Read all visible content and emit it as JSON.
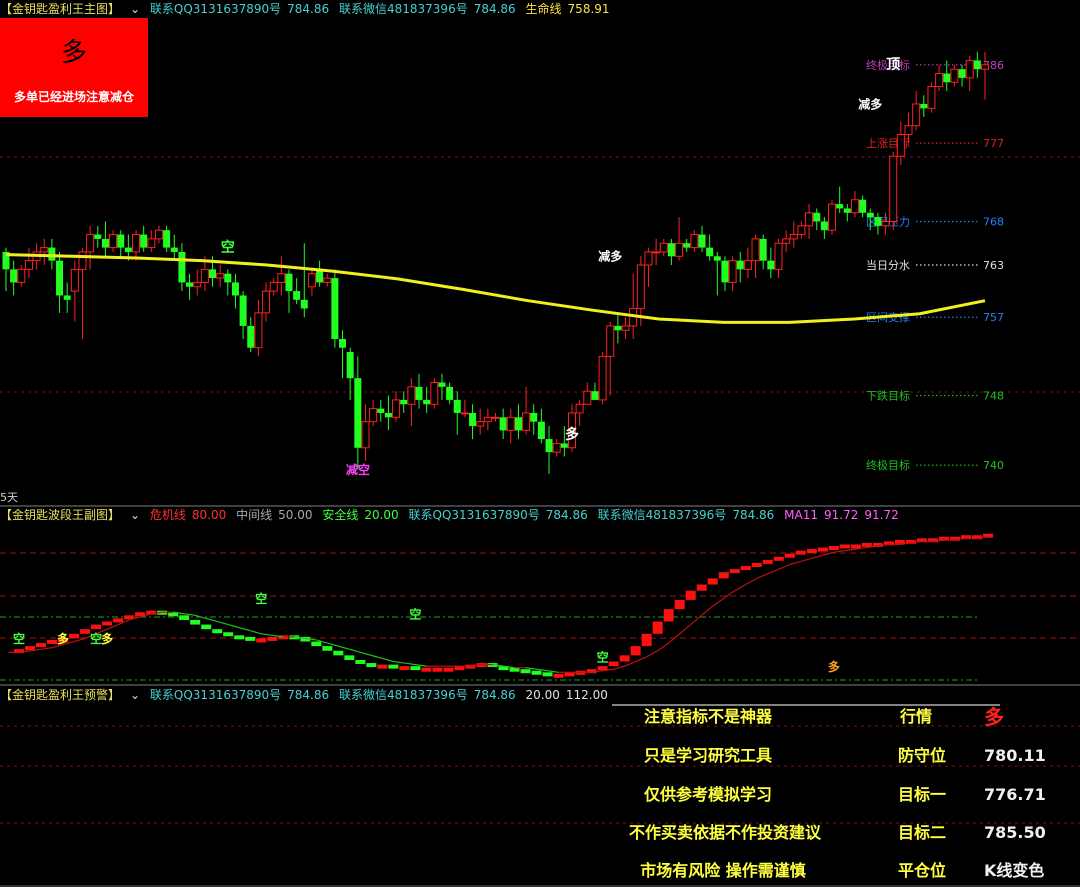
{
  "main_header": {
    "title": "【金钥匙盈利王主图】",
    "qq": "联系QQ3131637890号",
    "qq_val": "784.86",
    "wx": "联系微信481837396号",
    "wx_val": "784.86",
    "life_line_label": "生命线",
    "life_line_val": "758.91"
  },
  "signal_box": {
    "big": "多",
    "small": "多单已经进场注意减仓"
  },
  "days_label": "5天",
  "sub_header": {
    "title": "【金钥匙波段王副图】",
    "danger": "危机线",
    "danger_val": "80.00",
    "mid": "中间线",
    "mid_val": "50.00",
    "safe": "安全线",
    "safe_val": "20.00",
    "qq": "联系QQ3131637890号",
    "qq_val": "784.86",
    "wx": "联系微信481837396号",
    "wx_val": "784.86",
    "ma": "MA11",
    "ma_val": "91.72",
    "ma_val2": "91.72"
  },
  "warn_header": {
    "title": "【金钥匙盈利王预警】",
    "qq": "联系QQ3131637890号",
    "qq_val": "784.86",
    "wx": "联系微信481837396号",
    "wx_val": "784.86",
    "v1": "20.00",
    "v2": "112.00"
  },
  "info_table": [
    {
      "left": "注意指标不是神器",
      "key": "行情",
      "val": "多"
    },
    {
      "left": "只是学习研究工具",
      "key": "防守位",
      "val": "780.11"
    },
    {
      "left": "仅供参考模拟学习",
      "key": "目标一",
      "val": "776.71"
    },
    {
      "left": "不作买卖依据不作投资建议",
      "key": "目标二",
      "val": "785.50"
    },
    {
      "left": "市场有风险 操作需谨慎",
      "key": "平仓位",
      "val": "K线变色"
    }
  ],
  "chart_data": [
    {
      "type": "candlestick",
      "panel": "main",
      "ylim": [
        736,
        790
      ],
      "levels": [
        {
          "name": "终极目标",
          "value": 786,
          "color": "#c040c0"
        },
        {
          "name": "上涨目标",
          "value": 777,
          "color": "#e02020"
        },
        {
          "name": "区间压力",
          "value": 768,
          "color": "#2080ff"
        },
        {
          "name": "当日分水",
          "value": 763,
          "color": "#e0e0e0"
        },
        {
          "name": "区间支撑",
          "value": 757,
          "color": "#2080ff"
        },
        {
          "name": "下跌目标",
          "value": 748,
          "color": "#20c020"
        },
        {
          "name": "终极目标",
          "value": 740,
          "color": "#20c020"
        }
      ],
      "candles": [
        [
          764.5,
          762.5,
          760.0,
          765.0
        ],
        [
          762.5,
          761.0,
          759.5,
          763.5
        ],
        [
          761.0,
          762.5,
          760.5,
          763.0
        ],
        [
          762.5,
          763.5,
          761.5,
          765.0
        ],
        [
          763.5,
          764.5,
          762.5,
          765.5
        ],
        [
          764.5,
          765.0,
          763.0,
          766.0
        ],
        [
          765.0,
          763.5,
          762.5,
          766.0
        ],
        [
          763.5,
          759.5,
          757.5,
          764.5
        ],
        [
          759.5,
          759.0,
          757.5,
          761.0
        ],
        [
          760.0,
          762.5,
          756.5,
          763.5
        ],
        [
          762.5,
          764.5,
          754.5,
          765.0
        ],
        [
          764.5,
          766.5,
          762.5,
          767.5
        ],
        [
          766.5,
          766.0,
          765.0,
          767.5
        ],
        [
          766.0,
          765.0,
          764.0,
          768.0
        ],
        [
          765.0,
          766.5,
          764.5,
          767.0
        ],
        [
          766.5,
          765.0,
          764.0,
          767.0
        ],
        [
          765.0,
          764.5,
          763.5,
          766.5
        ],
        [
          764.5,
          766.5,
          763.5,
          767.0
        ],
        [
          766.5,
          765.0,
          764.5,
          767.5
        ],
        [
          765.0,
          766.0,
          764.5,
          767.0
        ],
        [
          766.0,
          767.0,
          765.5,
          767.5
        ],
        [
          767.0,
          765.0,
          764.5,
          767.5
        ],
        [
          765.0,
          764.5,
          763.5,
          766.5
        ],
        [
          764.5,
          761.0,
          760.0,
          765.5
        ],
        [
          761.0,
          760.5,
          759.0,
          762.0
        ],
        [
          760.5,
          761.0,
          759.5,
          762.5
        ],
        [
          761.0,
          762.5,
          760.0,
          764.0
        ],
        [
          762.5,
          761.5,
          760.5,
          764.0
        ],
        [
          761.5,
          762.0,
          760.5,
          763.0
        ],
        [
          762.0,
          761.0,
          759.5,
          762.5
        ],
        [
          761.0,
          759.5,
          758.0,
          762.0
        ],
        [
          759.5,
          756.0,
          754.5,
          760.0
        ],
        [
          756.0,
          753.5,
          753.0,
          757.0
        ],
        [
          753.5,
          757.5,
          752.5,
          759.0
        ],
        [
          757.5,
          760.0,
          756.5,
          761.0
        ],
        [
          760.0,
          761.0,
          759.5,
          761.5
        ],
        [
          761.0,
          762.0,
          759.5,
          764.0
        ],
        [
          762.0,
          760.0,
          757.5,
          762.5
        ],
        [
          760.0,
          759.0,
          758.5,
          761.5
        ],
        [
          759.0,
          758.0,
          757.0,
          765.5
        ],
        [
          760.5,
          762.0,
          759.5,
          762.5
        ],
        [
          762.5,
          761.0,
          760.5,
          763.5
        ],
        [
          761.0,
          761.5,
          760.5,
          762.0
        ],
        [
          761.5,
          754.5,
          753.5,
          762.5
        ],
        [
          754.5,
          753.5,
          750.0,
          755.5
        ],
        [
          753.0,
          750.0,
          747.5,
          753.5
        ],
        [
          750.0,
          742.0,
          739.5,
          752.5
        ],
        [
          742.0,
          745.0,
          740.5,
          747.0
        ],
        [
          745.0,
          746.5,
          744.5,
          747.5
        ],
        [
          746.5,
          746.0,
          745.0,
          747.5
        ],
        [
          746.0,
          745.5,
          744.0,
          748.0
        ],
        [
          745.5,
          747.5,
          745.0,
          748.5
        ],
        [
          747.5,
          747.0,
          746.0,
          748.5
        ],
        [
          747.0,
          749.0,
          744.5,
          750.0
        ],
        [
          749.0,
          747.5,
          746.5,
          750.5
        ],
        [
          747.5,
          747.0,
          746.0,
          749.0
        ],
        [
          747.0,
          749.5,
          746.5,
          750.0
        ],
        [
          749.5,
          749.0,
          747.5,
          750.5
        ],
        [
          749.0,
          747.5,
          747.0,
          749.5
        ],
        [
          747.5,
          746.0,
          743.5,
          748.5
        ],
        [
          746.0,
          746.0,
          745.5,
          747.5
        ],
        [
          746.0,
          744.5,
          743.0,
          747.0
        ],
        [
          744.5,
          745.0,
          743.5,
          746.5
        ],
        [
          745.0,
          745.5,
          744.0,
          746.5
        ],
        [
          745.5,
          745.5,
          745.0,
          746.0
        ],
        [
          745.5,
          744.0,
          743.0,
          746.5
        ],
        [
          744.0,
          745.5,
          742.5,
          746.5
        ],
        [
          745.5,
          744.0,
          743.0,
          747.0
        ],
        [
          744.0,
          746.0,
          743.5,
          749.0
        ],
        [
          746.0,
          745.0,
          743.5,
          747.0
        ],
        [
          745.0,
          743.0,
          742.5,
          746.5
        ],
        [
          743.0,
          741.5,
          739.0,
          744.5
        ],
        [
          741.5,
          742.5,
          741.0,
          743.0
        ],
        [
          742.5,
          742.0,
          741.0,
          744.5
        ],
        [
          742.0,
          746.0,
          741.5,
          747.0
        ],
        [
          746.0,
          747.0,
          744.5,
          747.5
        ],
        [
          747.0,
          748.5,
          747.0,
          749.5
        ],
        [
          748.5,
          747.5,
          747.5,
          749.5
        ],
        [
          747.5,
          752.5,
          747.0,
          753.0
        ],
        [
          752.5,
          756.0,
          748.0,
          756.5
        ],
        [
          756.0,
          755.5,
          754.0,
          757.5
        ],
        [
          755.5,
          756.0,
          754.5,
          757.0
        ],
        [
          756.0,
          758.0,
          754.5,
          762.0
        ],
        [
          758.0,
          763.0,
          756.0,
          764.0
        ],
        [
          763.0,
          764.5,
          760.5,
          765.0
        ],
        [
          764.5,
          764.5,
          763.0,
          766.0
        ],
        [
          764.5,
          765.5,
          764.0,
          766.0
        ],
        [
          765.5,
          764.0,
          763.0,
          766.0
        ],
        [
          764.0,
          765.5,
          763.5,
          768.5
        ],
        [
          765.5,
          765.0,
          764.5,
          766.0
        ],
        [
          765.0,
          766.5,
          764.5,
          767.0
        ],
        [
          766.5,
          765.0,
          764.5,
          767.5
        ],
        [
          765.0,
          764.0,
          763.5,
          766.5
        ],
        [
          764.0,
          763.5,
          759.5,
          764.5
        ],
        [
          763.5,
          761.0,
          760.0,
          764.0
        ],
        [
          761.0,
          763.5,
          760.0,
          764.0
        ],
        [
          763.5,
          762.5,
          761.0,
          764.5
        ],
        [
          762.5,
          763.5,
          761.5,
          765.0
        ],
        [
          763.5,
          766.0,
          761.5,
          766.5
        ],
        [
          766.0,
          763.5,
          762.5,
          766.5
        ],
        [
          763.5,
          762.5,
          761.5,
          765.0
        ],
        [
          762.5,
          765.5,
          761.5,
          766.0
        ],
        [
          765.5,
          766.0,
          764.5,
          767.0
        ],
        [
          766.0,
          766.5,
          765.0,
          768.0
        ],
        [
          766.5,
          767.5,
          766.0,
          768.0
        ],
        [
          767.5,
          769.0,
          766.0,
          770.0
        ],
        [
          769.0,
          768.0,
          767.0,
          769.5
        ],
        [
          768.0,
          767.0,
          766.0,
          768.5
        ],
        [
          767.0,
          770.0,
          766.5,
          770.5
        ],
        [
          770.0,
          769.5,
          769.0,
          772.0
        ],
        [
          769.5,
          769.0,
          768.0,
          770.0
        ],
        [
          769.0,
          770.5,
          768.5,
          771.5
        ],
        [
          770.5,
          769.0,
          768.5,
          771.0
        ],
        [
          769.0,
          768.5,
          767.0,
          769.5
        ],
        [
          768.5,
          767.5,
          766.5,
          769.0
        ],
        [
          767.5,
          768.0,
          766.5,
          769.0
        ],
        [
          768.0,
          775.5,
          767.0,
          776.0
        ],
        [
          775.5,
          778.0,
          774.5,
          779.5
        ],
        [
          778.0,
          779.0,
          777.0,
          780.5
        ],
        [
          779.0,
          781.5,
          778.5,
          783.0
        ],
        [
          781.5,
          781.0,
          780.0,
          782.5
        ],
        [
          781.0,
          783.5,
          780.5,
          784.0
        ],
        [
          783.5,
          785.0,
          783.0,
          786.0
        ],
        [
          785.0,
          784.0,
          783.0,
          786.5
        ],
        [
          784.0,
          785.5,
          783.5,
          786.0
        ],
        [
          785.5,
          784.5,
          783.5,
          786.0
        ],
        [
          784.5,
          786.5,
          783.0,
          787.0
        ],
        [
          786.5,
          785.5,
          784.5,
          787.5
        ],
        [
          785.5,
          786.0,
          782.0,
          787.5
        ]
      ],
      "life_line": [
        764.2,
        764.0,
        763.8,
        763.5,
        763.0,
        762.3,
        761.4,
        760.2,
        758.9,
        757.8,
        756.8,
        756.4,
        756.4,
        756.8,
        757.4,
        758.9
      ],
      "annotations": [
        {
          "text": "空",
          "color": "#40ff40",
          "i": 29,
          "y": 764.5
        },
        {
          "text": "减空",
          "color": "#ff40ff",
          "i": 46,
          "y": 739.0
        },
        {
          "text": "多",
          "color": "#ffffff",
          "i": 74,
          "y": 743.0
        },
        {
          "text": "减多",
          "color": "#ffffff",
          "i": 79,
          "y": 763.5
        },
        {
          "text": "减多",
          "color": "#ffffff",
          "i": 113,
          "y": 781.0
        },
        {
          "text": "顶",
          "color": "#ffffff",
          "i": 116,
          "y": 785.5
        }
      ]
    },
    {
      "type": "step-oscillator",
      "panel": "sub",
      "ylim": [
        0,
        100
      ],
      "hlines": [
        80,
        50,
        20
      ],
      "colors": {
        "up": "#ff1010",
        "down": "#20ff20",
        "ma": "#c01010",
        "ma_alt": "#20c020"
      },
      "series": [
        {
          "name": "波段",
          "values": [
            20,
            20,
            22,
            24,
            26,
            27,
            30,
            33,
            36,
            38,
            40,
            42,
            44,
            45,
            44,
            42,
            39,
            36,
            33,
            31,
            29,
            28,
            27,
            27,
            28,
            29,
            28,
            25,
            22,
            19,
            16,
            13,
            11,
            10,
            10,
            9,
            9,
            8,
            8,
            8,
            8,
            9,
            10,
            11,
            9,
            8,
            7,
            6,
            5,
            4,
            4,
            5,
            6,
            7,
            9,
            12,
            16,
            22,
            30,
            38,
            46,
            52,
            58,
            62,
            66,
            70,
            72,
            74,
            76,
            78,
            80,
            82,
            84,
            85,
            86,
            87,
            88,
            88,
            89,
            89,
            90,
            91,
            91,
            92,
            92,
            93,
            93,
            94,
            94,
            95
          ]
        },
        {
          "name": "MA11",
          "values": [
            18,
            18,
            19,
            20,
            21,
            23,
            25,
            27,
            30,
            33,
            36,
            39,
            41,
            43,
            44,
            44,
            43,
            42,
            40,
            38,
            36,
            34,
            32,
            30,
            29,
            28,
            28,
            27,
            26,
            24,
            22,
            20,
            18,
            16,
            14,
            12,
            11,
            10,
            9,
            9,
            9,
            9,
            9,
            10,
            10,
            9,
            8,
            8,
            7,
            6,
            5,
            5,
            5,
            5,
            6,
            7,
            9,
            12,
            15,
            19,
            24,
            30,
            36,
            42,
            48,
            53,
            58,
            62,
            66,
            69,
            72,
            75,
            77,
            79,
            81,
            83,
            84,
            85,
            86,
            87,
            88,
            88,
            89,
            90,
            90,
            91,
            91,
            92,
            92,
            93
          ]
        }
      ],
      "annotations": [
        {
          "text": "空",
          "color": "#40ff40",
          "i": 1,
          "y": 24
        },
        {
          "text": "多",
          "color": "#ffff40",
          "i": 5,
          "y": 24
        },
        {
          "text": "空",
          "color": "#40ff40",
          "i": 8,
          "y": 24
        },
        {
          "text": "多",
          "color": "#ffff40",
          "i": 9,
          "y": 24
        },
        {
          "text": "空",
          "color": "#40ff40",
          "i": 23,
          "y": 50
        },
        {
          "text": "空",
          "color": "#40ff40",
          "i": 37,
          "y": 40
        },
        {
          "text": "空",
          "color": "#40ff40",
          "i": 54,
          "y": 12
        },
        {
          "text": "多",
          "color": "#ffa020",
          "i": 75,
          "y": 6
        }
      ]
    }
  ]
}
